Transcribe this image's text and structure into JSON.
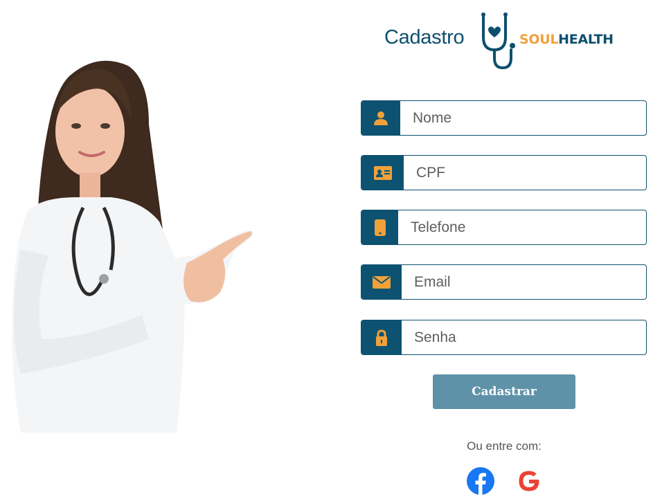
{
  "header": {
    "title": "Cadastro"
  },
  "logo": {
    "part1": "SOUL",
    "part2": "HEALTH"
  },
  "form": {
    "fields": [
      {
        "id": "nome",
        "placeholder": "Nome",
        "icon": "user-icon"
      },
      {
        "id": "cpf",
        "placeholder": "CPF",
        "icon": "id-card-icon"
      },
      {
        "id": "telefone",
        "placeholder": "Telefone",
        "icon": "phone-icon"
      },
      {
        "id": "email",
        "placeholder": "Email",
        "icon": "envelope-icon"
      },
      {
        "id": "senha",
        "placeholder": "Senha",
        "icon": "lock-icon"
      }
    ],
    "submit_label": "Cadastrar"
  },
  "social": {
    "label": "Ou entre com:",
    "providers": [
      "facebook-icon",
      "google-icon"
    ]
  },
  "colors": {
    "primary": "#0d4f6e",
    "accent": "#f0a13a",
    "button": "#5f92a8",
    "facebook": "#1877f2",
    "google": "#ea4335"
  }
}
